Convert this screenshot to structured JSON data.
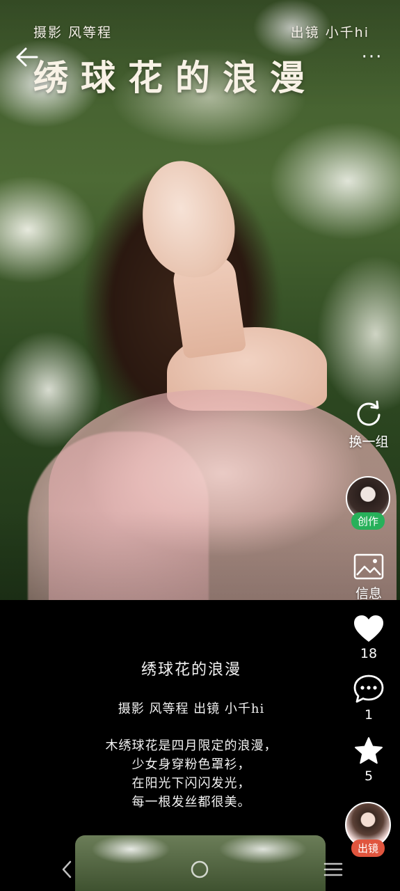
{
  "header": {
    "photographer_credit": "摄影  风等程",
    "model_credit": "出镜  小千hi",
    "title": "绣球花的浪漫",
    "more_label": "···"
  },
  "rail": {
    "swap_label": "换一组",
    "create_badge": "创作",
    "info_label": "信息",
    "likes": "18",
    "comments": "1",
    "favorites": "5",
    "cameo_badge": "出镜"
  },
  "caption": {
    "title": "绣球花的浪漫",
    "credit": "摄影  风等程    出镜  小千hi",
    "poem": [
      "木绣球花是四月限定的浪漫，",
      "少女身穿粉色罩衫，",
      "在阳光下闪闪发光，",
      "每一根发丝都很美。"
    ]
  },
  "colors": {
    "create_badge": "#27b05a",
    "cameo_badge": "#e0553e",
    "background": "#000000"
  },
  "icons": [
    "back-arrow-icon",
    "more-icon",
    "refresh-icon",
    "image-icon",
    "heart-icon",
    "comment-icon",
    "star-icon",
    "nav-back-icon",
    "nav-home-icon",
    "nav-menu-icon"
  ]
}
